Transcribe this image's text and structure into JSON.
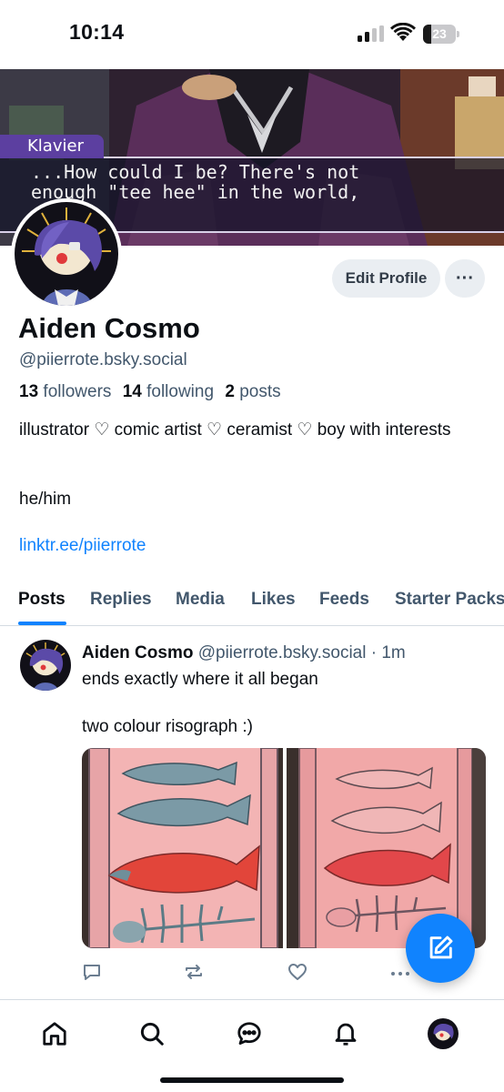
{
  "status_bar": {
    "time": "10:14",
    "battery": "23"
  },
  "banner": {
    "speaker": "Klavier",
    "caption": "...How could I be? There's not enough \"tee hee\" in the world, case."
  },
  "profile": {
    "edit_label": "Edit Profile",
    "more_label": "···",
    "display_name": "Aiden Cosmo",
    "handle": "@piierrote.bsky.social",
    "followers_count": "13",
    "followers_label": "followers",
    "following_count": "14",
    "following_label": "following",
    "posts_count": "2",
    "posts_label": "posts",
    "bio": "illustrator  ♡  comic artist ♡ ceramist ♡ boy with interests",
    "pronouns": "he/him",
    "link": "linktr.ee/piierrote"
  },
  "tabs": [
    "Posts",
    "Replies",
    "Media",
    "Likes",
    "Feeds",
    "Starter Packs"
  ],
  "post": {
    "author": "Aiden Cosmo",
    "handle": "@piierrote.bsky.social",
    "time": "· 1m",
    "line1": "ends exactly where it all began",
    "line2": "two colour risograph :)"
  },
  "icons": {
    "reply": "reply-icon",
    "repost": "repost-icon",
    "like": "heart-icon",
    "more": "more-icon",
    "compose": "compose-icon",
    "home": "home-icon",
    "search": "search-icon",
    "chat": "chat-icon",
    "notifications": "bell-icon"
  },
  "colors": {
    "accent": "#1083fe",
    "muted": "#42576c",
    "button_bg": "#eaeef2"
  }
}
